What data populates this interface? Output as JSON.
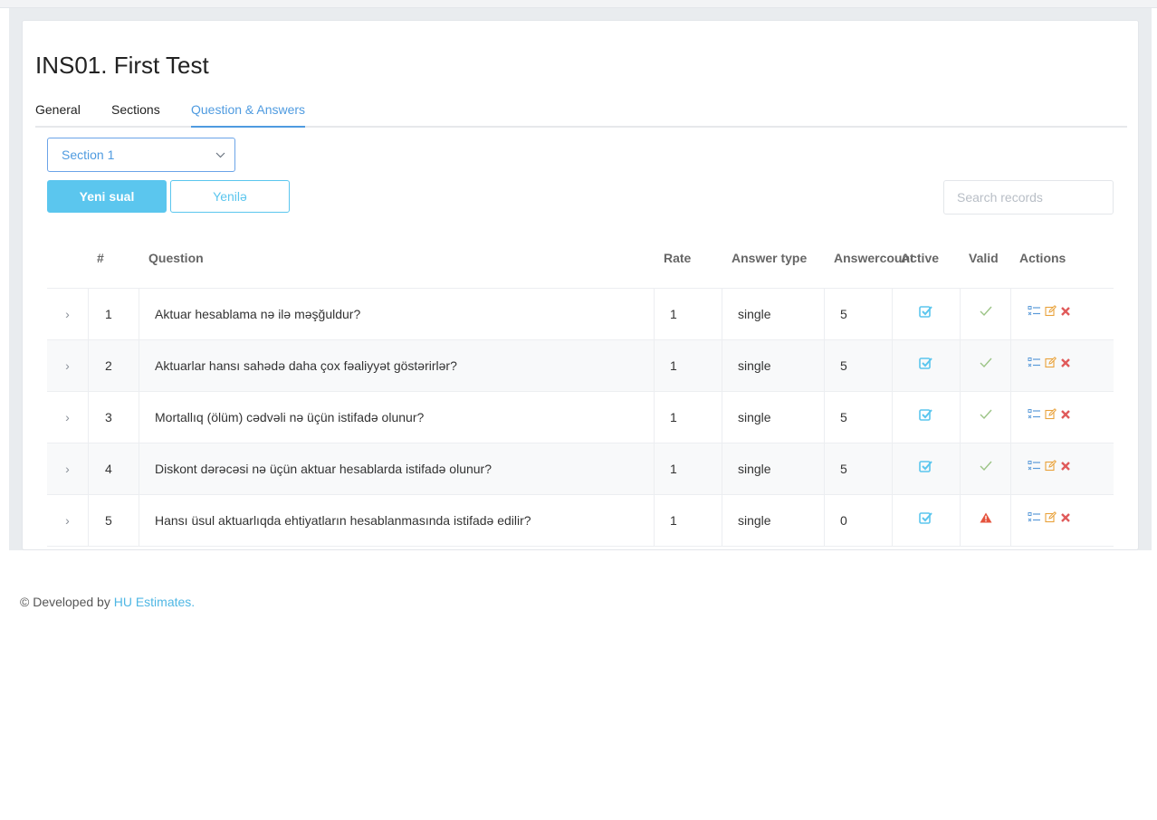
{
  "page": {
    "title": "INS01. First Test"
  },
  "tabs": [
    {
      "label": "General",
      "active": false
    },
    {
      "label": "Sections",
      "active": false
    },
    {
      "label": "Question & Answers",
      "active": true
    }
  ],
  "section_select": {
    "value": "Section 1"
  },
  "toolbar": {
    "new_label": "Yeni sual",
    "refresh_label": "Yenilə"
  },
  "search": {
    "placeholder": "Search records",
    "value": ""
  },
  "table": {
    "columns": {
      "num": "#",
      "question": "Question",
      "rate": "Rate",
      "answer_type": "Answer type",
      "answer_count_1": "Answer",
      "answer_count_2": "count",
      "active": "Active",
      "valid": "Valid",
      "actions": "Actions"
    },
    "rows": [
      {
        "num": "1",
        "question": "Aktuar hesablama nə ilə məşğuldur?",
        "rate": "1",
        "type": "single",
        "count": "5",
        "active": true,
        "valid": true
      },
      {
        "num": "2",
        "question": "Aktuarlar hansı sahədə daha çox fəaliyyət göstərirlər?",
        "rate": "1",
        "type": "single",
        "count": "5",
        "active": true,
        "valid": true
      },
      {
        "num": "3",
        "question": "Mortallıq (ölüm) cədvəli nə üçün istifadə olunur?",
        "rate": "1",
        "type": "single",
        "count": "5",
        "active": true,
        "valid": true
      },
      {
        "num": "4",
        "question": "Diskont dərəcəsi nə üçün aktuar hesablarda istifadə olunur?",
        "rate": "1",
        "type": "single",
        "count": "5",
        "active": true,
        "valid": true
      },
      {
        "num": "5",
        "question": "Hansı üsul aktuarlıqda ehtiyatların hesablanmasında istifadə edilir?",
        "rate": "1",
        "type": "single",
        "count": "0",
        "active": true,
        "valid": false
      }
    ]
  },
  "footer": {
    "prefix": "© Developed by",
    "link": "HU Estimates."
  },
  "colors": {
    "accent": "#4f9be0",
    "button": "#5bc6ee",
    "check": "#8fc07a",
    "delete": "#e05a5a",
    "warning": "#e5533d"
  },
  "icons": {
    "expand": "chevron-right-icon",
    "active": "checkbox-checked-icon",
    "valid": "check-icon",
    "invalid": "warning-icon",
    "actions": [
      "answers-list-icon",
      "edit-icon",
      "delete-icon"
    ]
  }
}
